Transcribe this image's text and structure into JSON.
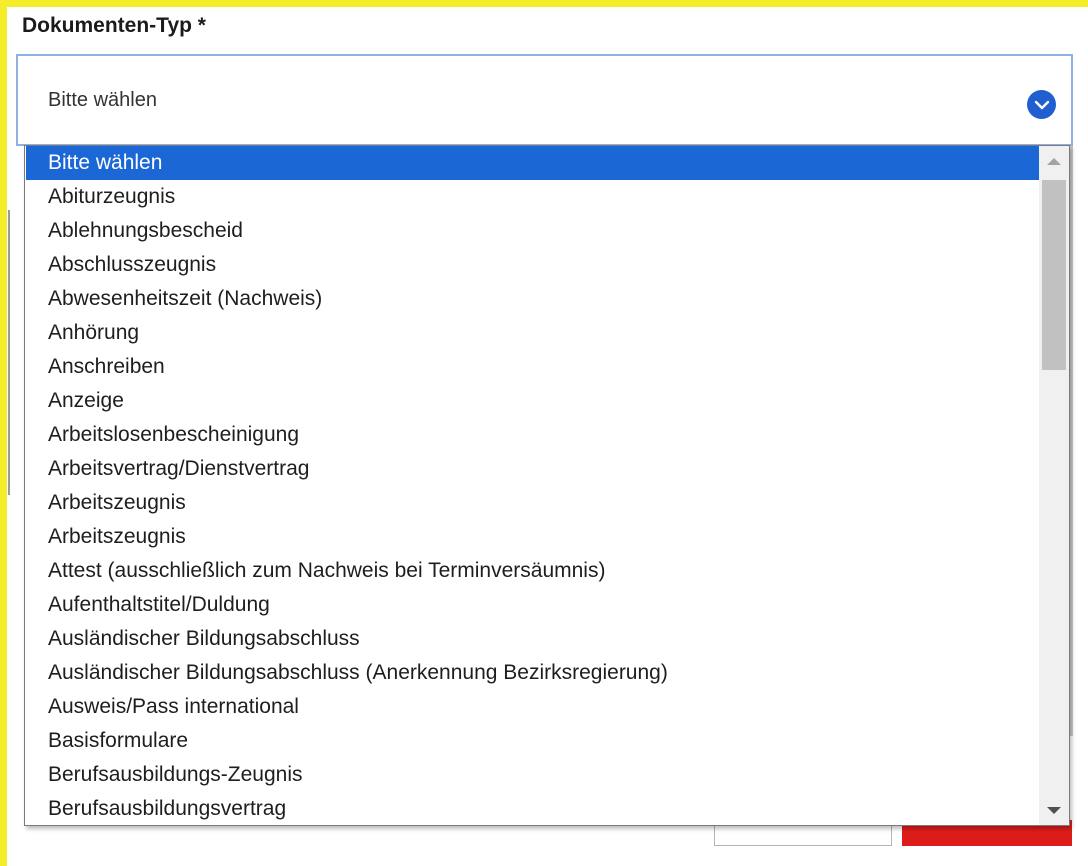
{
  "form": {
    "field_label": "Dokumenten-Typ *",
    "select_value": "Bitte wählen"
  },
  "dropdown": {
    "selected_index": 0,
    "options": [
      "Bitte wählen",
      "Abiturzeugnis",
      "Ablehnungsbescheid",
      "Abschlusszeugnis",
      "Abwesenheitszeit (Nachweis)",
      "Anhörung",
      "Anschreiben",
      "Anzeige",
      "Arbeitslosenbescheinigung",
      "Arbeitsvertrag/Dienstvertrag",
      "Arbeitszeugnis",
      "Arbeitszeugnis",
      "Attest (ausschließlich zum Nachweis bei Terminversäumnis)",
      "Aufenthaltstitel/Duldung",
      "Ausländischer Bildungsabschluss",
      "Ausländischer Bildungsabschluss (Anerkennung Bezirksregierung)",
      "Ausweis/Pass international",
      "Basisformulare",
      "Berufsausbildungs-Zeugnis",
      "Berufsausbildungsvertrag"
    ]
  },
  "icons": {
    "select_chevron": "chevron-down-icon",
    "scroll_up": "arrow-up-icon",
    "scroll_down": "arrow-down-icon"
  },
  "colors": {
    "highlight": "#f4ed2a",
    "accent": "#1b67d6",
    "select_border": "#8fb1e0",
    "danger_button": "#dd1c1a"
  }
}
